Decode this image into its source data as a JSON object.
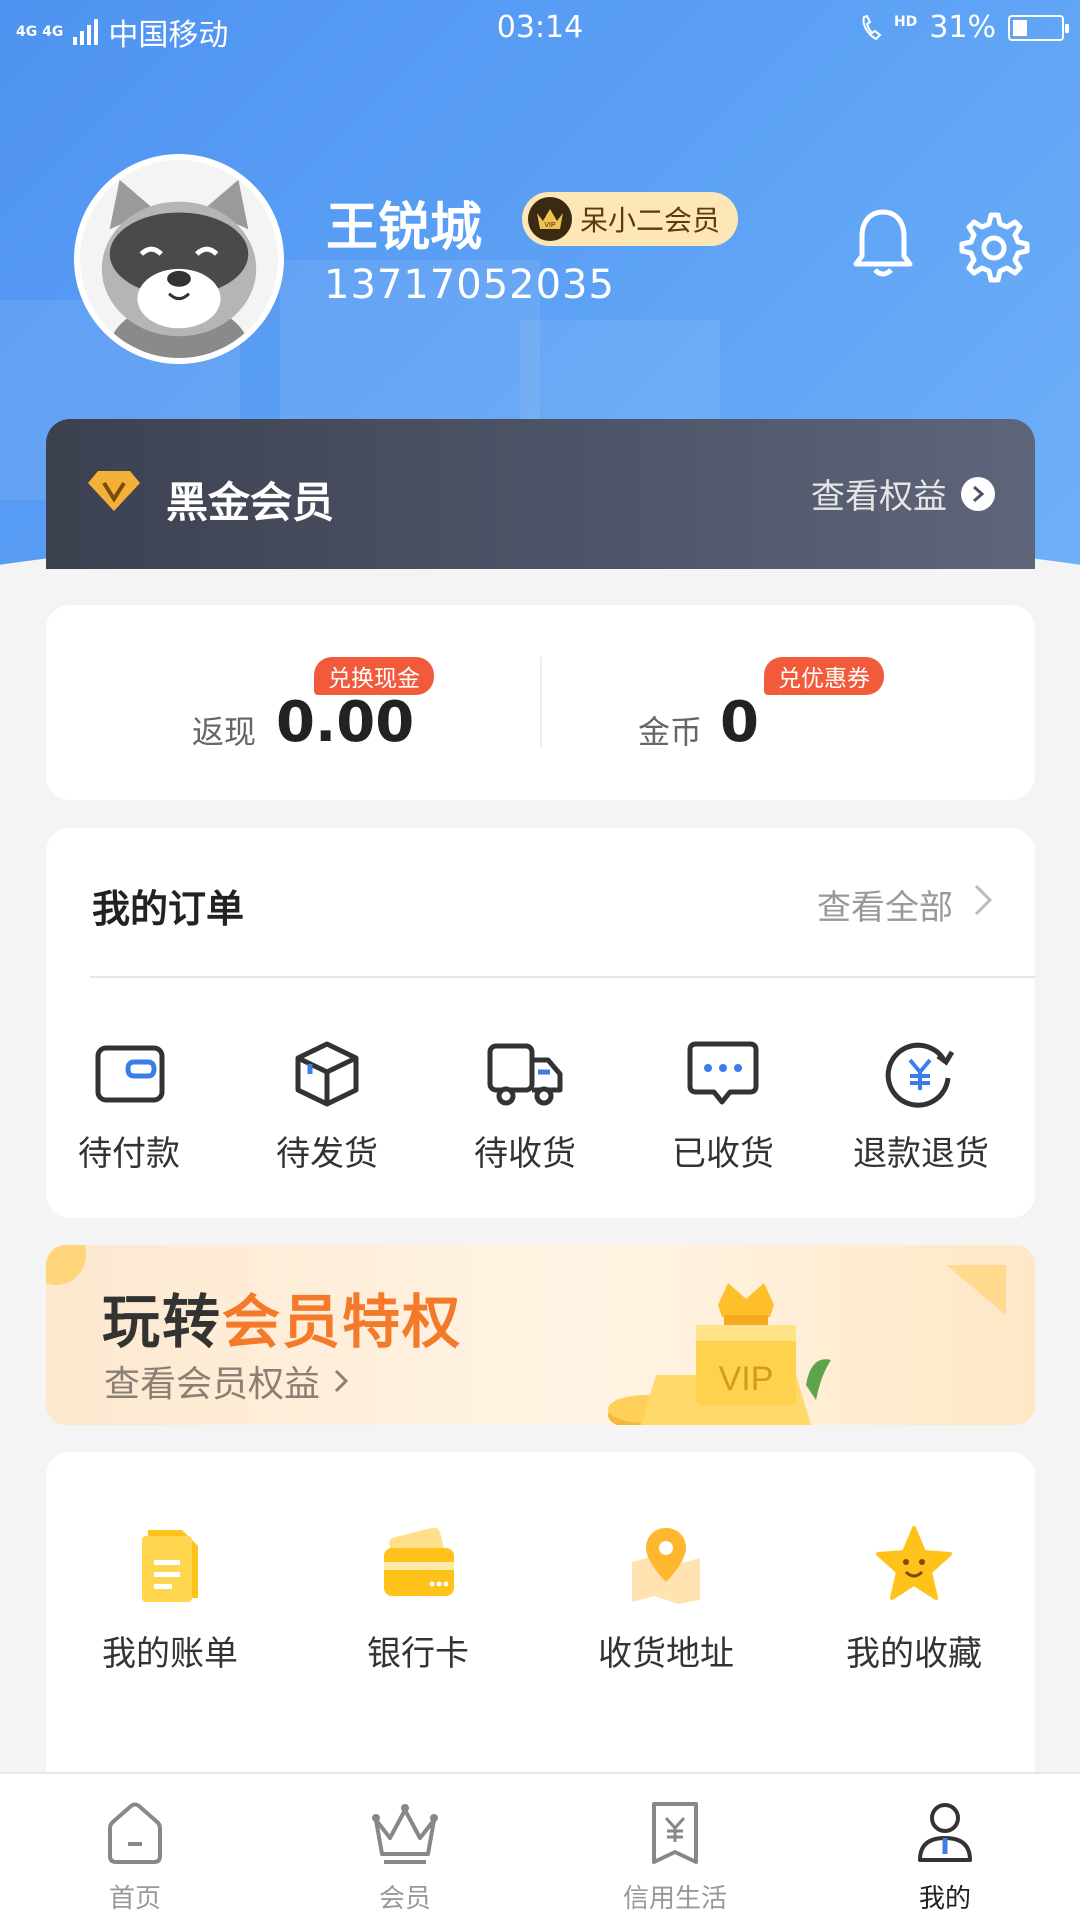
{
  "status_bar": {
    "network": "4G 4G",
    "carrier": "中国移动",
    "time": "03:14",
    "hd": "HD",
    "battery": "31%"
  },
  "profile": {
    "name": "王锐城",
    "member_badge": "呆小二会员",
    "badge_vip": "VIP",
    "phone": "13717052035"
  },
  "black_gold": {
    "title": "黑金会员",
    "view": "查看权益"
  },
  "cash": {
    "rebate_label": "返现",
    "rebate_value": "0.00",
    "rebate_tag": "兑换现金",
    "coin_label": "金币",
    "coin_value": "0",
    "coin_tag": "兑优惠券"
  },
  "orders": {
    "title": "我的订单",
    "view_all": "查看全部",
    "items": [
      {
        "label": "待付款",
        "icon": "wallet-icon"
      },
      {
        "label": "待发货",
        "icon": "box-icon"
      },
      {
        "label": "待收货",
        "icon": "truck-icon"
      },
      {
        "label": "已收货",
        "icon": "message-icon"
      },
      {
        "label": "退款退货",
        "icon": "refund-icon"
      }
    ]
  },
  "banner": {
    "title_prefix": "玩转",
    "title_highlight": "会员特权",
    "subtitle": "查看会员权益",
    "vip_text": "VIP"
  },
  "services": [
    {
      "label": "我的账单",
      "icon": "bill-icon"
    },
    {
      "label": "银行卡",
      "icon": "bank-card-icon"
    },
    {
      "label": "收货地址",
      "icon": "location-icon"
    },
    {
      "label": "我的收藏",
      "icon": "star-icon"
    }
  ],
  "tabs": [
    {
      "label": "首页",
      "icon": "home-icon",
      "active": false
    },
    {
      "label": "会员",
      "icon": "crown-icon",
      "active": false
    },
    {
      "label": "信用生活",
      "icon": "credit-icon",
      "active": false
    },
    {
      "label": "我的",
      "icon": "user-icon",
      "active": true
    }
  ],
  "colors": {
    "header_blue": "#5da2f5",
    "accent_orange": "#f47a2a",
    "tag_red": "#f25a3c",
    "service_yellow": "#ffc21a"
  }
}
